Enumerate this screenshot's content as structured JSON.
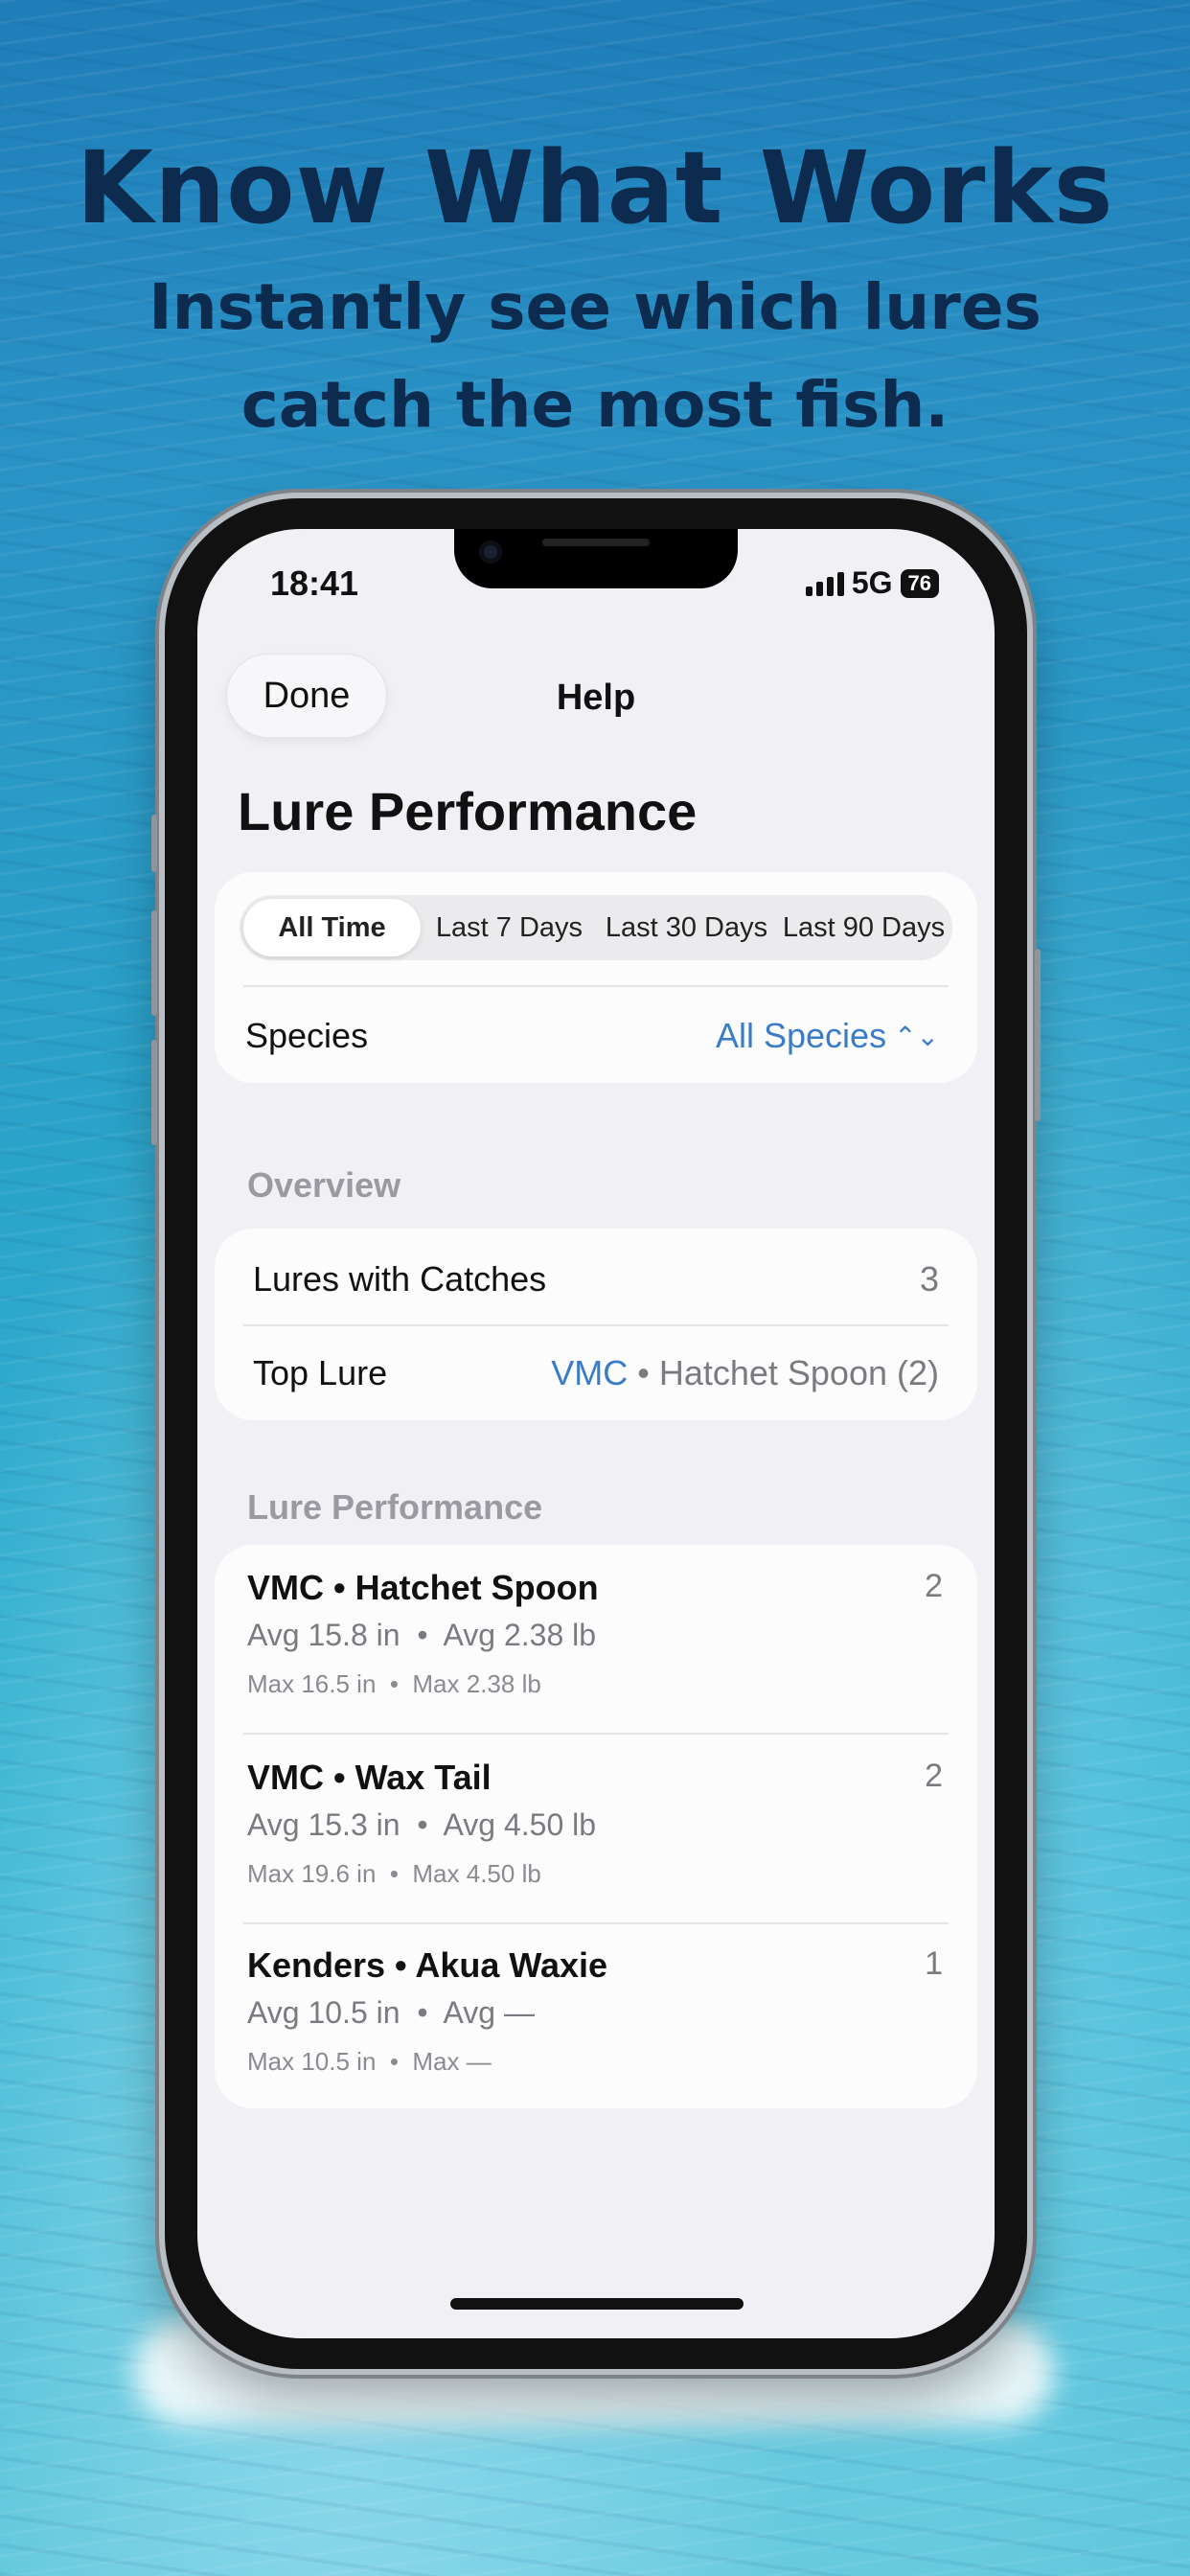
{
  "promo": {
    "headline": "Know What Works",
    "subline": "Instantly see which lures catch the most fish."
  },
  "status_bar": {
    "time": "18:41",
    "network": "5G",
    "battery": "76"
  },
  "nav": {
    "done_label": "Done",
    "title": "Help"
  },
  "page_title": "Lure Performance",
  "time_filter": {
    "options": [
      "All Time",
      "Last 7 Days",
      "Last 30 Days",
      "Last 90 Days"
    ],
    "selected": "All Time"
  },
  "species_filter": {
    "label": "Species",
    "value": "All Species"
  },
  "overview": {
    "header": "Overview",
    "rows": [
      {
        "label": "Lures with Catches",
        "value": "3"
      },
      {
        "label": "Top Lure",
        "brand": "VMC",
        "rest": "• Hatchet Spoon (2)"
      }
    ]
  },
  "performance": {
    "header": "Lure Performance",
    "lures": [
      {
        "name": "VMC • Hatchet Spoon",
        "count": "2",
        "avg": "Avg 15.8 in  •  Avg 2.38 lb",
        "max": "Max 16.5 in  •  Max 2.38 lb"
      },
      {
        "name": "VMC • Wax Tail",
        "count": "2",
        "avg": "Avg 15.3 in  •  Avg 4.50 lb",
        "max": "Max 19.6 in  •  Max 4.50 lb"
      },
      {
        "name": "Kenders • Akua Waxie",
        "count": "1",
        "avg": "Avg 10.5 in  •  Avg —",
        "max": "Max 10.5 in  •  Max —"
      }
    ]
  },
  "colors": {
    "link": "#3a7cc8",
    "headline": "#0d2a4f"
  }
}
